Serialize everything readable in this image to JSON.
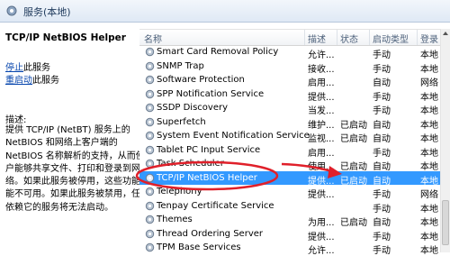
{
  "window": {
    "title": "服务(本地)"
  },
  "left_pane": {
    "service_title": "TCP/IP NetBIOS Helper",
    "actions": [
      {
        "link": "停止",
        "suffix": "此服务"
      },
      {
        "link": "重启动",
        "suffix": "此服务"
      }
    ],
    "description_label": "描述:",
    "description_lines": [
      "提供 TCP/IP (NetBT) 服务上的",
      "NetBIOS 和网络上客户端的",
      "NetBIOS 名称解析的支持，从而使用",
      "户能够共享文件、打印和登录到网",
      "络。如果此服务被停用，这些功能可",
      "能不可用。如果此服务被禁用，任何",
      "依赖它的服务将无法启动。"
    ]
  },
  "columns": {
    "name": "名称",
    "desc": "描述",
    "status": "状态",
    "startup": "启动类型",
    "logon": "登录"
  },
  "rows": [
    {
      "name": "Smart Card Removal Policy",
      "desc": "允许...",
      "status": "",
      "startup": "手动",
      "logon": "本地"
    },
    {
      "name": "SNMP Trap",
      "desc": "接收...",
      "status": "",
      "startup": "手动",
      "logon": "本地"
    },
    {
      "name": "Software Protection",
      "desc": "启用...",
      "status": "",
      "startup": "自动",
      "logon": "网络"
    },
    {
      "name": "SPP Notification Service",
      "desc": "提供...",
      "status": "",
      "startup": "手动",
      "logon": "本地"
    },
    {
      "name": "SSDP Discovery",
      "desc": "当发...",
      "status": "",
      "startup": "手动",
      "logon": "本地"
    },
    {
      "name": "Superfetch",
      "desc": "维护...",
      "status": "已启动",
      "startup": "自动",
      "logon": "本地"
    },
    {
      "name": "System Event Notification Service",
      "desc": "监视...",
      "status": "已启动",
      "startup": "自动",
      "logon": "本地"
    },
    {
      "name": "Tablet PC Input Service",
      "desc": "启用...",
      "status": "",
      "startup": "手动",
      "logon": "本地"
    },
    {
      "name": "Task Scheduler",
      "desc": "使用...",
      "status": "已启动",
      "startup": "自动",
      "logon": "本地"
    },
    {
      "name": "TCP/IP NetBIOS Helper",
      "desc": "提供...",
      "status": "已启动",
      "startup": "自动",
      "logon": "本地",
      "selected": true
    },
    {
      "name": "Telephony",
      "desc": "提供...",
      "status": "",
      "startup": "手动",
      "logon": "网络"
    },
    {
      "name": "Tenpay Certificate Service",
      "desc": "",
      "status": "",
      "startup": "手动",
      "logon": "本地"
    },
    {
      "name": "Themes",
      "desc": "为用...",
      "status": "已启动",
      "startup": "自动",
      "logon": "本地"
    },
    {
      "name": "Thread Ordering Server",
      "desc": "提供...",
      "status": "",
      "startup": "手动",
      "logon": "本地"
    },
    {
      "name": "TPM Base Services",
      "desc": "允许...",
      "status": "",
      "startup": "手动",
      "logon": "本地"
    }
  ],
  "colors": {
    "selection": "#3399ff",
    "annotation": "#e0202a",
    "link": "#0645ad"
  },
  "icons": {
    "service": "gear-icon",
    "app": "services-app-icon"
  }
}
